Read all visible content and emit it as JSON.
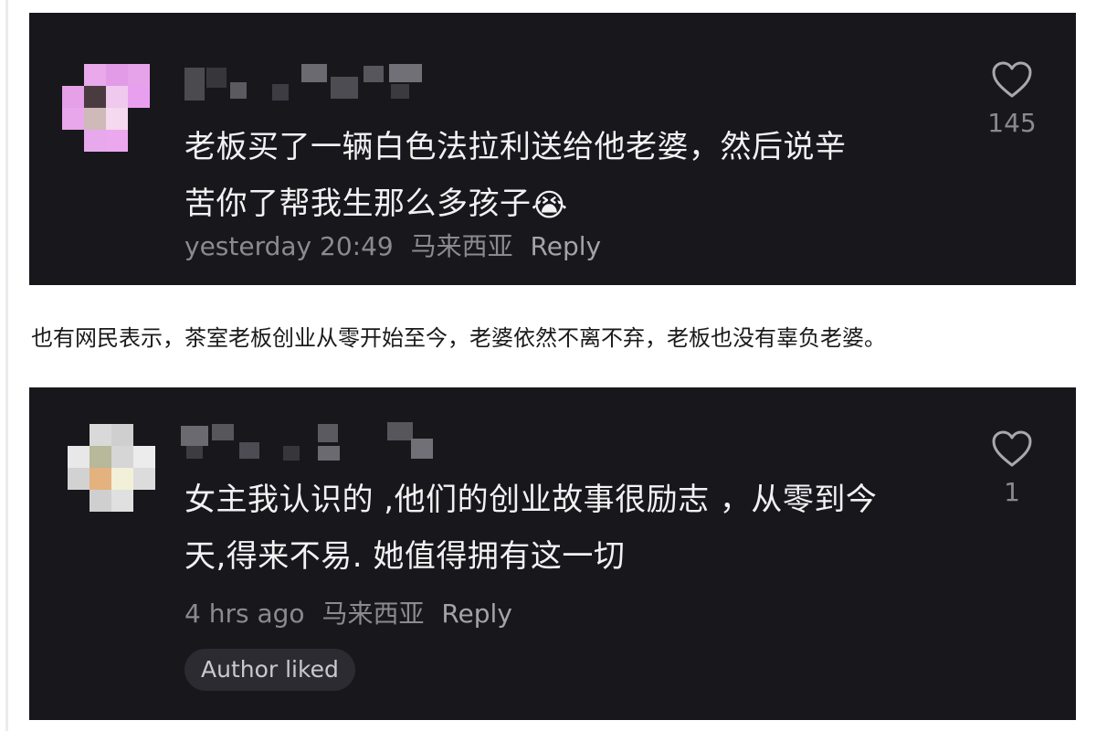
{
  "comments": [
    {
      "text_line1": "老板买了一辆白色法拉利送给他老婆，然后说辛",
      "text_line2": "苦你了帮我生那么多孩子",
      "emoji": "😭",
      "time": "yesterday 20:49",
      "location": "马来西亚",
      "reply_label": "Reply",
      "like_count": "145",
      "like_icon": "heart-outline-icon"
    },
    {
      "text_line1": "女主我认识的 ,他们的创业故事很励志 ，从零到今",
      "text_line2": "天,得来不易. 她值得拥有这一切",
      "time": "4 hrs ago",
      "location": "马来西亚",
      "reply_label": "Reply",
      "like_count": "1",
      "like_icon": "heart-outline-icon",
      "badge": "Author liked"
    }
  ],
  "article": {
    "paragraph": "也有网民表示，茶室老板创业从零开始至今，老婆依然不离不弃，老板也没有辜负老婆。"
  },
  "colors": {
    "card_background": "#18171c",
    "comment_text": "#f2f2f2",
    "meta_text": "#8a8a90",
    "badge_background": "#2c2b31"
  }
}
